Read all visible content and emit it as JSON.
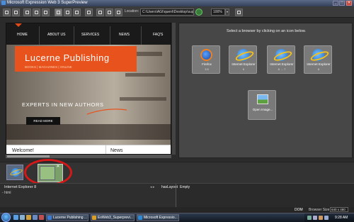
{
  "window": {
    "title": "Microsoft Expression Web 3 SuperPreview",
    "min": "_",
    "max": "□",
    "close": "✕"
  },
  "toolbar": {
    "location_label": "Location:",
    "location_value": "C:\\Users\\AGI\\quent\\Desktop\\supes",
    "zoom_value": "100%",
    "zoom_arrow": "▾"
  },
  "preview": {
    "nav": [
      "HOME",
      "ABOUT US",
      "SERVICES",
      "NEWS",
      "FAQ'S"
    ],
    "brand": "Lucerne Publishing",
    "tagline": "BOOKS | MAGAZINES | ONLINE",
    "headline": "EXPERTS IN NEW AUTHORS",
    "cta": "READ MORE",
    "welcome": "Welcome!",
    "news": "News"
  },
  "browser_picker": {
    "instruction": "Select a browser by clicking on an icon below.",
    "browsers": [
      {
        "name": "Firefox",
        "version": "3.5",
        "icon": "firefox-icon"
      },
      {
        "name": "Internet Explorer",
        "version": "6",
        "icon": "ie-icon"
      },
      {
        "name": "Internet Explorer",
        "version": "8 → 7",
        "icon": "ie-icon"
      },
      {
        "name": "Internet Explorer",
        "version": "8",
        "icon": "ie-icon"
      }
    ],
    "open_image": "Open Image..."
  },
  "session": {
    "close": "✕"
  },
  "dom": {
    "browser": "Internet Explorer 8",
    "html_node": "- html",
    "arrows": "◂ ▸",
    "property": "hasLayout",
    "value": "Empty",
    "tab": "DOM",
    "browser_size_label": "Browser Size",
    "browser_size_value": "640 x 480"
  },
  "taskbar": {
    "tasks": [
      {
        "label": "Lucerne Publishing ...",
        "color": "#3a7ad8"
      },
      {
        "label": "ExWeb3_Superprevi...",
        "color": "#d8a02a"
      },
      {
        "label": "Microsoft Expressio...",
        "color": "#2a8ad8"
      }
    ],
    "clock": "9:28 AM"
  },
  "colors": {
    "accent": "#e8521c",
    "highlight_circle": "#d41818"
  }
}
